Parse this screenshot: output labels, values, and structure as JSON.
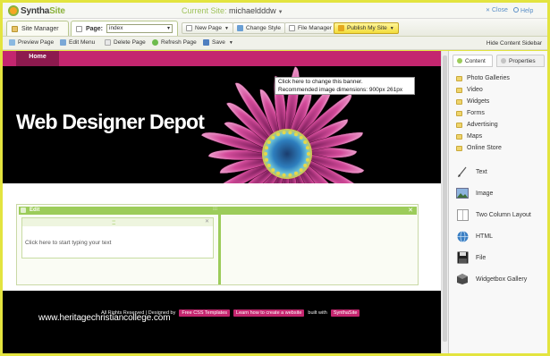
{
  "header": {
    "logo_prefix": "Syntha",
    "logo_suffix": "Site",
    "current_site_label": "Current Site:",
    "current_site_value": "michaeldddw",
    "close_label": "Close",
    "help_label": "Help"
  },
  "tabs": {
    "site_manager": "Site Manager",
    "page_label": "Page:",
    "page_value": "index",
    "new_page": "New Page",
    "change_style": "Change Style",
    "file_manager": "File Manager",
    "publish": "Publish My Site"
  },
  "toolbar": {
    "preview": "Preview Page",
    "edit_menu": "Edit Menu",
    "delete_page": "Delete Page",
    "refresh_page": "Refresh Page",
    "save": "Save",
    "hide_sidebar": "Hide Content Sidebar"
  },
  "page": {
    "nav_home": "Home",
    "site_title": "Web Designer Depot",
    "banner_tooltip_line1": "Click here to change this banner.",
    "banner_tooltip_line2": "Recommended image dimensions: 900px 261px",
    "edit_label": "Edit",
    "placeholder": "Click here to start typing your text",
    "footer_copyright": "All Rights Reserved | Designed by",
    "footer_pill1": "Free CSS Templates",
    "footer_pill2": "Learn how to create a website",
    "footer_built": "built with",
    "footer_pill3": "SynthaSite",
    "watermark": "www.heritagechristiancollege.com"
  },
  "sidebar": {
    "tab_content": "Content",
    "tab_properties": "Properties",
    "folders": [
      "Photo Galleries",
      "Video",
      "Widgets",
      "Forms",
      "Advertising",
      "Maps",
      "Online Store"
    ],
    "widgets": [
      {
        "label": "Text",
        "icon": "text-icon"
      },
      {
        "label": "Image",
        "icon": "image-icon"
      },
      {
        "label": "Two Column Layout",
        "icon": "two-column-icon"
      },
      {
        "label": "HTML",
        "icon": "html-icon"
      },
      {
        "label": "File",
        "icon": "file-icon"
      },
      {
        "label": "Widgetbox Gallery",
        "icon": "widgetbox-icon"
      }
    ]
  },
  "colors": {
    "frame": "#e3e43f",
    "nav_pink": "#c4266f",
    "accent_green": "#9ccc5a"
  }
}
